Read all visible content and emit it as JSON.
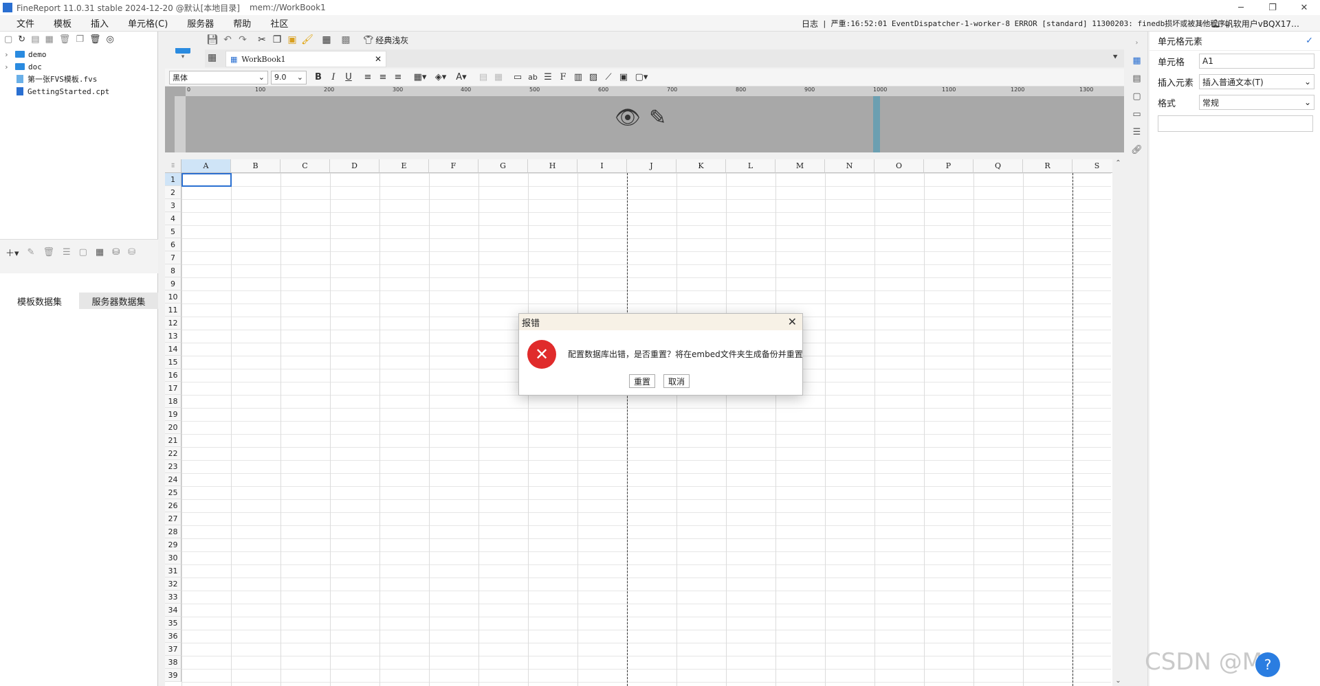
{
  "window": {
    "title": "FineReport 11.0.31 stable 2024-12-20 @默认[本地目录]",
    "path": "mem://WorkBook1"
  },
  "menu": [
    "文件",
    "模板",
    "插入",
    "单元格(C)",
    "服务器",
    "帮助",
    "社区"
  ],
  "menubar": {
    "log_label": "日志",
    "log_text": "严重:16:52:01 EventDispatcher-1-worker-8 ERROR [standard] 11300203: finedb损坏或被其他程序…",
    "user": "帆软用户vBQX17…"
  },
  "tree": {
    "items": [
      {
        "type": "folder",
        "name": "demo"
      },
      {
        "type": "folder",
        "name": "doc"
      },
      {
        "type": "file",
        "name": "第一张FVS模板.fvs"
      },
      {
        "type": "file",
        "name": "GettingStarted.cpt"
      }
    ]
  },
  "datasets": {
    "tab_template": "模板数据集",
    "tab_server": "服务器数据集"
  },
  "toolbar": {
    "classic_theme": "经典浅灰"
  },
  "workbook_tab": {
    "name": "WorkBook1"
  },
  "format": {
    "font": "黑体",
    "size": "9.0"
  },
  "ruler": {
    "ticks": [
      "0",
      "100",
      "200",
      "300",
      "400",
      "500",
      "600",
      "700",
      "800",
      "900",
      "1000",
      "1100",
      "1200",
      "1300"
    ]
  },
  "grid": {
    "columns": [
      "A",
      "B",
      "C",
      "D",
      "E",
      "F",
      "G",
      "H",
      "I",
      "J",
      "K",
      "L",
      "M",
      "N",
      "O",
      "P",
      "Q",
      "R",
      "S"
    ],
    "rows": [
      "1",
      "2",
      "3",
      "4",
      "5",
      "6",
      "7",
      "8",
      "9",
      "10",
      "11",
      "12",
      "13",
      "14",
      "15",
      "16",
      "17",
      "18",
      "19",
      "20",
      "21",
      "22",
      "23",
      "24",
      "25",
      "26",
      "27",
      "28",
      "29",
      "30",
      "31",
      "32",
      "33",
      "34",
      "35",
      "36",
      "37",
      "38",
      "39"
    ],
    "selected_cell": "A1"
  },
  "right_panel": {
    "title": "单元格元素",
    "cell_label": "单元格",
    "cell_value": "A1",
    "insert_label": "插入元素",
    "insert_value": "插入普通文本(T)",
    "format_label": "格式",
    "format_value": "常规"
  },
  "dialog": {
    "title": "报错",
    "message": "配置数据库出错，是否重置？将在embed文件夹生成备份并重置",
    "reset_button": "重置",
    "cancel_button": "取消"
  },
  "watermark": "CSDN @M"
}
